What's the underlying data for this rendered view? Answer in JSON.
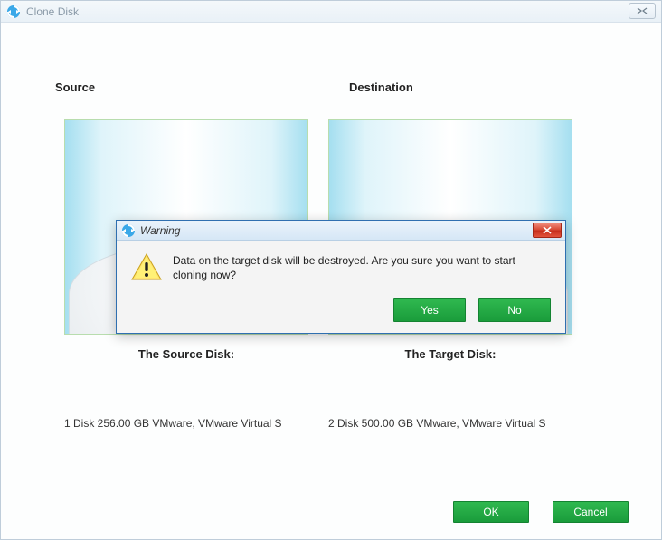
{
  "window": {
    "title": "Clone Disk"
  },
  "headers": {
    "source": "Source",
    "destination": "Destination"
  },
  "subtitles": {
    "source": "The Source Disk:",
    "target": "The Target Disk:"
  },
  "disks": {
    "source_info": "1 Disk 256.00 GB VMware,  VMware Virtual S",
    "target_info": "2 Disk 500.00 GB VMware,  VMware Virtual S"
  },
  "footer": {
    "ok": "OK",
    "cancel": "Cancel"
  },
  "dialog": {
    "title": "Warning",
    "message": "Data on the target disk will be destroyed. Are you sure you want to start cloning now?",
    "yes": "Yes",
    "no": "No"
  }
}
